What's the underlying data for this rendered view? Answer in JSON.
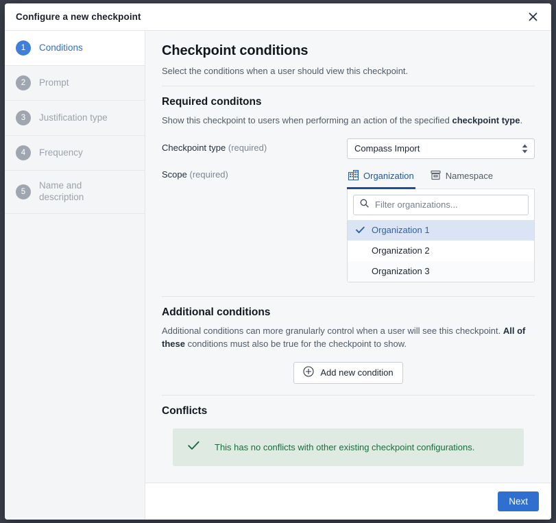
{
  "window": {
    "title": "Configure a new checkpoint",
    "close_label": "×"
  },
  "sidebar": {
    "steps": [
      {
        "num": "1",
        "label": "Conditions"
      },
      {
        "num": "2",
        "label": "Prompt"
      },
      {
        "num": "3",
        "label": "Justification type"
      },
      {
        "num": "4",
        "label": "Frequency"
      },
      {
        "num": "5",
        "label": "Name and description"
      }
    ]
  },
  "main": {
    "title": "Checkpoint conditions",
    "subtitle": "Select the conditions when a user should view this checkpoint.",
    "required": {
      "heading": "Required conditons",
      "desc_start": "Show this checkpoint to users when performing an action of the specified ",
      "desc_bold": "checkpoint type",
      "desc_end": ".",
      "checkpoint_type_label": "Checkpoint type",
      "checkpoint_type_required": "(required)",
      "checkpoint_type_value": "Compass Import",
      "scope_label": "Scope",
      "scope_required": "(required)",
      "tabs": [
        {
          "label": "Organization",
          "icon": "building-icon",
          "active": true
        },
        {
          "label": "Namespace",
          "icon": "archive-icon",
          "active": false
        }
      ],
      "filter_placeholder": "Filter organizations...",
      "filter_value": "",
      "options": [
        {
          "label": "Organization 1",
          "selected": true
        },
        {
          "label": "Organization 2",
          "selected": false
        },
        {
          "label": "Organization 3",
          "selected": false
        }
      ]
    },
    "additional": {
      "heading": "Additional conditions",
      "desc_start": "Additional conditions can more granularly control when a user will see this checkpoint. ",
      "desc_bold": "All of these",
      "desc_end": " conditions must also be true for the checkpoint to show.",
      "add_button": "Add new condition"
    },
    "conflicts": {
      "heading": "Conflicts",
      "banner_text": "This has no conflicts with other existing checkpoint configurations."
    }
  },
  "footer": {
    "next_label": "Next"
  },
  "colors": {
    "accent": "#2f6fd0",
    "active_step": "#3d7fd9",
    "inactive_step": "#9fa6b0",
    "tab_active": "#1f4f99",
    "selected_row_bg": "#dbe4f5",
    "banner_bg": "#dfeae3",
    "banner_text": "#1b6b3d",
    "sidebar_bg": "#f4f5f7",
    "content_bg": "#f6f7f9"
  }
}
